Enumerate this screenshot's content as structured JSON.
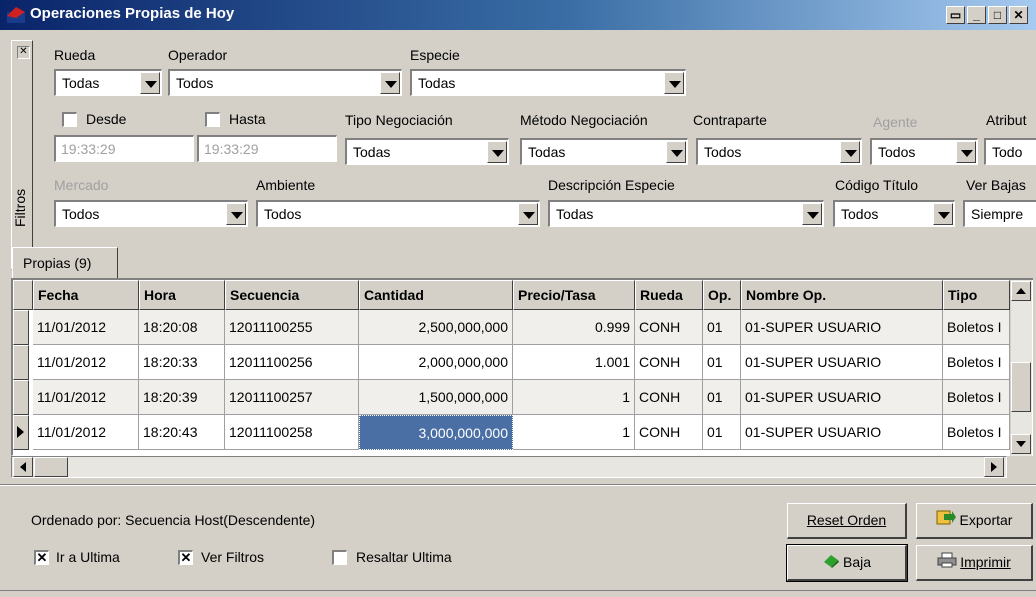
{
  "window": {
    "title": "Operaciones Propias de Hoy"
  },
  "filters": {
    "panel_label": "Filtros",
    "rueda": {
      "label": "Rueda",
      "value": "Todas"
    },
    "operador": {
      "label": "Operador",
      "value": "Todos"
    },
    "especie": {
      "label": "Especie",
      "value": "Todas"
    },
    "desde": {
      "label": "Desde",
      "value": "19:33:29"
    },
    "hasta": {
      "label": "Hasta",
      "value": "19:33:29"
    },
    "tipo_negociacion": {
      "label": "Tipo Negociación",
      "value": "Todas"
    },
    "metodo_negociacion": {
      "label": "Método Negociación",
      "value": "Todas"
    },
    "contraparte": {
      "label": "Contraparte",
      "value": "Todos"
    },
    "agente": {
      "label": "Agente",
      "value": "Todos"
    },
    "atributo": {
      "label": "Atribut",
      "value": "Todo"
    },
    "mercado": {
      "label": "Mercado",
      "value": "Todos"
    },
    "ambiente": {
      "label": "Ambiente",
      "value": "Todos"
    },
    "descripcion_especie": {
      "label": "Descripción Especie",
      "value": "Todas"
    },
    "codigo_titulo": {
      "label": "Código Título",
      "value": "Todos"
    },
    "ver_bajas": {
      "label": "Ver Bajas",
      "value": "Siempre"
    }
  },
  "tab": {
    "label": "Propias (9)"
  },
  "grid": {
    "columns": [
      "Fecha",
      "Hora",
      "Secuencia",
      "Cantidad",
      "Precio/Tasa",
      "Rueda",
      "Op.",
      "Nombre Op.",
      "Tipo"
    ],
    "rows": [
      [
        "11/01/2012",
        "18:20:08",
        "12011100255",
        "2,500,000,000",
        "0.999",
        "CONH",
        "01",
        "01-SUPER USUARIO",
        "Boletos I"
      ],
      [
        "11/01/2012",
        "18:20:33",
        "12011100256",
        "2,000,000,000",
        "1.001",
        "CONH",
        "01",
        "01-SUPER USUARIO",
        "Boletos I"
      ],
      [
        "11/01/2012",
        "18:20:39",
        "12011100257",
        "1,500,000,000",
        "1",
        "CONH",
        "01",
        "01-SUPER USUARIO",
        "Boletos I"
      ],
      [
        "11/01/2012",
        "18:20:43",
        "12011100258",
        "3,000,000,000",
        "1",
        "CONH",
        "01",
        "01-SUPER USUARIO",
        "Boletos I"
      ]
    ]
  },
  "footer": {
    "ordenado_por": "Ordenado por: Secuencia Host(Descendente)",
    "ir_a_ultima": "Ir a Ultima",
    "ver_filtros": "Ver Filtros",
    "resaltar_ultima": "Resaltar Ultima",
    "reset_orden": "Reset Orden",
    "exportar": "Exportar",
    "baja": "Baja",
    "imprimir": "Imprimir"
  }
}
